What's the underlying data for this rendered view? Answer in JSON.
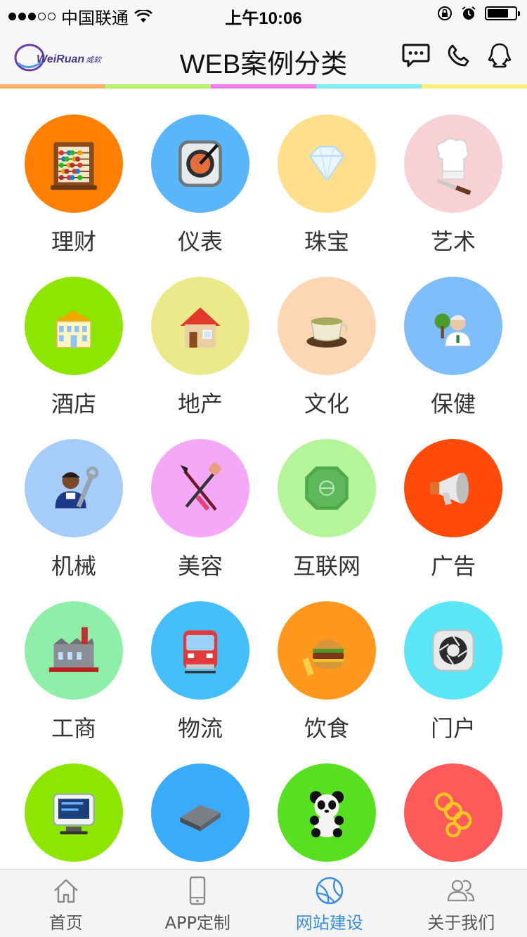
{
  "status_bar": {
    "carrier": "中国联通",
    "time": "上午10:06",
    "signal_dots": [
      true,
      true,
      true,
      false,
      false
    ],
    "battery_level": 0.75
  },
  "nav": {
    "logo_text": "WeiRuan",
    "logo_cn": "威软",
    "title": "WEB案例分类",
    "icons": [
      "message-icon",
      "phone-icon",
      "qq-icon"
    ]
  },
  "stripe_colors": [
    "#f7b06a",
    "#b8ef6b",
    "#ef7de8",
    "#7eeef2",
    "#f6f07a"
  ],
  "categories": [
    {
      "label": "理财",
      "bg": "#ff7f00",
      "icon": "abacus-icon"
    },
    {
      "label": "仪表",
      "bg": "#5ab6fb",
      "icon": "gauge-icon"
    },
    {
      "label": "珠宝",
      "bg": "#ffdf8c",
      "icon": "diamond-icon"
    },
    {
      "label": "艺术",
      "bg": "#f7d1d3",
      "icon": "chef-hat-icon"
    },
    {
      "label": "酒店",
      "bg": "#8ee600",
      "icon": "hotel-icon"
    },
    {
      "label": "地产",
      "bg": "#ece98a",
      "icon": "house-icon"
    },
    {
      "label": "文化",
      "bg": "#fdd7b4",
      "icon": "tea-icon"
    },
    {
      "label": "保健",
      "bg": "#7fbefb",
      "icon": "doctor-icon"
    },
    {
      "label": "机械",
      "bg": "#a6cdfa",
      "icon": "mechanic-icon"
    },
    {
      "label": "美容",
      "bg": "#f6a8f8",
      "icon": "makeup-brush-icon"
    },
    {
      "label": "互联网",
      "bg": "#b5f59a",
      "icon": "internet-icon"
    },
    {
      "label": "广告",
      "bg": "#ff4a08",
      "icon": "megaphone-icon"
    },
    {
      "label": "工商",
      "bg": "#8ef0a8",
      "icon": "factory-icon"
    },
    {
      "label": "物流",
      "bg": "#45bffa",
      "icon": "train-icon"
    },
    {
      "label": "饮食",
      "bg": "#ff981d",
      "icon": "burger-icon"
    },
    {
      "label": "门户",
      "bg": "#5be6f7",
      "icon": "aperture-icon"
    },
    {
      "label": "",
      "bg": "#8ee600",
      "icon": "monitor-icon"
    },
    {
      "label": "",
      "bg": "#3aaafa",
      "icon": "device-icon"
    },
    {
      "label": "",
      "bg": "#56e020",
      "icon": "panda-icon"
    },
    {
      "label": "",
      "bg": "#ff5a5a",
      "icon": "rings-icon"
    }
  ],
  "tabs": [
    {
      "label": "首页",
      "icon": "home-icon",
      "active": false
    },
    {
      "label": "APP定制",
      "icon": "mobile-icon",
      "active": false
    },
    {
      "label": "网站建设",
      "icon": "globe-icon",
      "active": true
    },
    {
      "label": "关于我们",
      "icon": "users-icon",
      "active": false
    }
  ]
}
